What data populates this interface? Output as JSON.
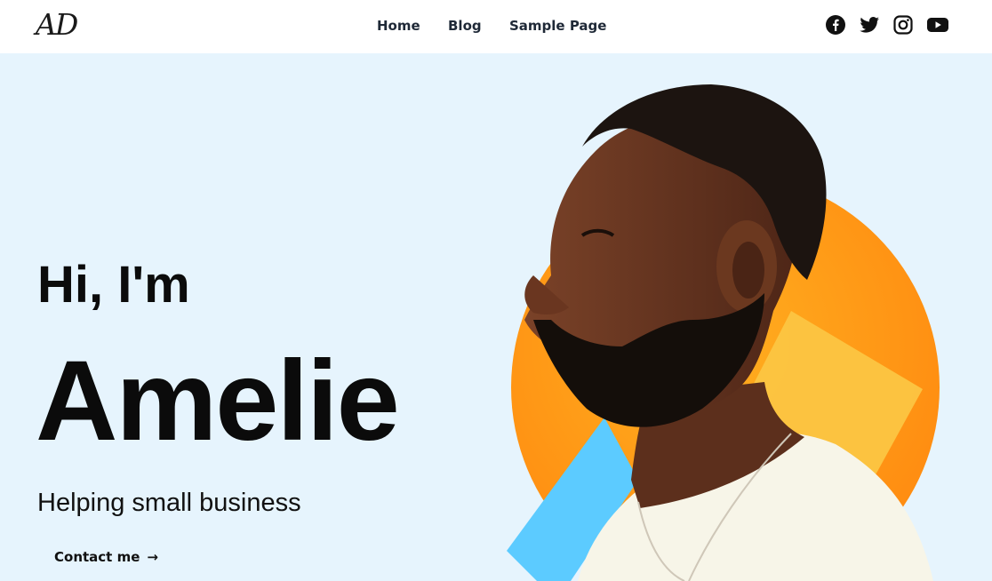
{
  "header": {
    "logo_text": "AD",
    "nav": [
      {
        "label": "Home"
      },
      {
        "label": "Blog"
      },
      {
        "label": "Sample Page"
      }
    ],
    "social": [
      {
        "icon": "facebook-icon"
      },
      {
        "icon": "twitter-icon"
      },
      {
        "icon": "instagram-icon"
      },
      {
        "icon": "youtube-icon"
      }
    ]
  },
  "hero": {
    "greeting": "Hi, I'm",
    "name": "Amelie",
    "tagline": "Helping small business",
    "cta_label": "Contact me",
    "cta_arrow": "→"
  },
  "colors": {
    "hero_background": "#e6f4fd",
    "accent_orange": "#ff9a16",
    "accent_yellow": "#fcc542",
    "accent_blue": "#5ccbff",
    "text_dark": "#0b0b0b"
  }
}
